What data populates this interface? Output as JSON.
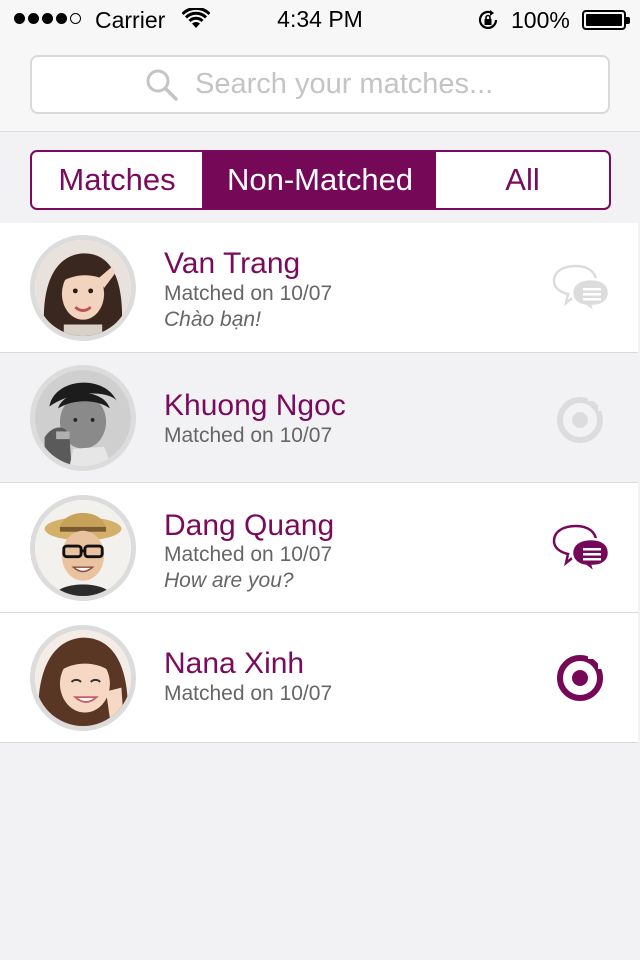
{
  "status_bar": {
    "carrier": "Carrier",
    "time": "4:34 PM",
    "battery": "100%"
  },
  "search": {
    "placeholder": "Search your matches..."
  },
  "tabs": [
    {
      "label": "Matches",
      "selected": false
    },
    {
      "label": "Non-Matched",
      "selected": true
    },
    {
      "label": "All",
      "selected": false
    }
  ],
  "matches": [
    {
      "name": "Van Trang",
      "matched": "Matched on 10/07",
      "message": "Chào bạn!",
      "action_icon": "chat-icon",
      "active": false
    },
    {
      "name": "Khuong Ngoc",
      "matched": "Matched on 10/07",
      "message": "",
      "action_icon": "target-icon",
      "active": false
    },
    {
      "name": "Dang Quang",
      "matched": "Matched on 10/07",
      "message": "How are you?",
      "action_icon": "chat-icon",
      "active": true
    },
    {
      "name": "Nana Xinh",
      "matched": "Matched on 10/07",
      "message": "",
      "action_icon": "target-icon",
      "active": true
    }
  ],
  "colors": {
    "accent": "#760957",
    "inactive_icon": "#d9d9d9",
    "avatar_ring": "#dcdcdc"
  }
}
